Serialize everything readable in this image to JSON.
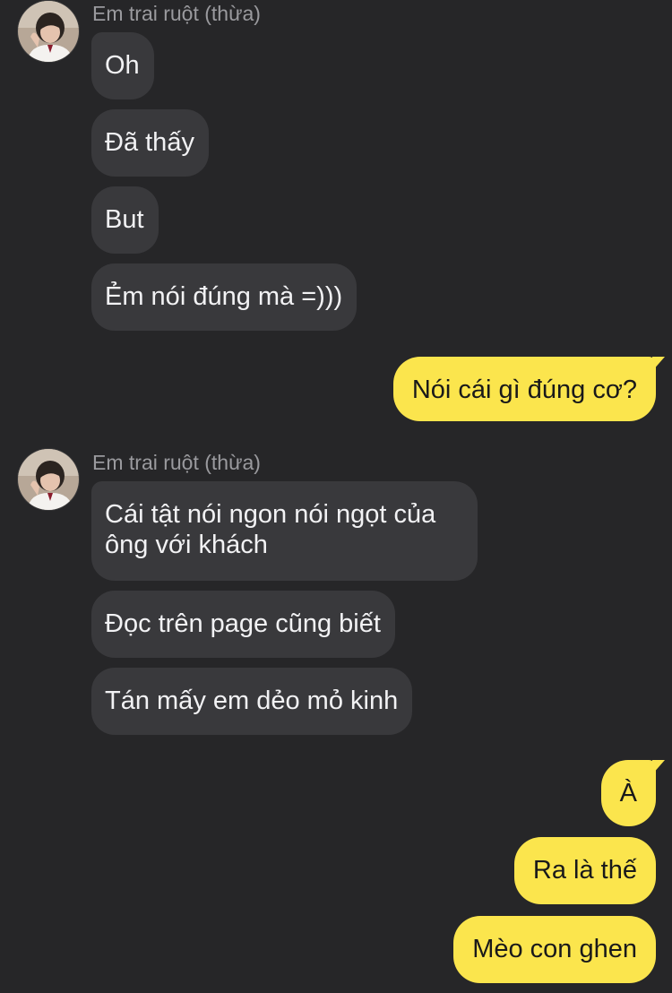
{
  "conversation": {
    "sender_name": "Em trai ruột (thừa)",
    "groups": [
      {
        "sender": "Em trai ruột (thừa)",
        "messages": [
          "Oh",
          "Đã thấy",
          "But",
          "Ẻm nói đúng mà =)))"
        ]
      },
      {
        "sender": "me",
        "messages": [
          "Nói cái gì đúng cơ?"
        ]
      },
      {
        "sender": "Em trai ruột (thừa)",
        "messages": [
          "Cái tật nói ngon nói ngọt của ông với khách",
          "Đọc trên page cũng biết",
          "Tán mấy em dẻo mỏ kinh"
        ]
      },
      {
        "sender": "me",
        "messages": [
          "À",
          "Ra là thế",
          "Mèo con ghen"
        ]
      }
    ]
  },
  "colors": {
    "background": "#262628",
    "incoming_bubble": "#39393c",
    "outgoing_bubble": "#fbe54d",
    "sender_name": "#9a9a9e"
  },
  "icons": {
    "contact_avatar": "avatar-photo"
  }
}
